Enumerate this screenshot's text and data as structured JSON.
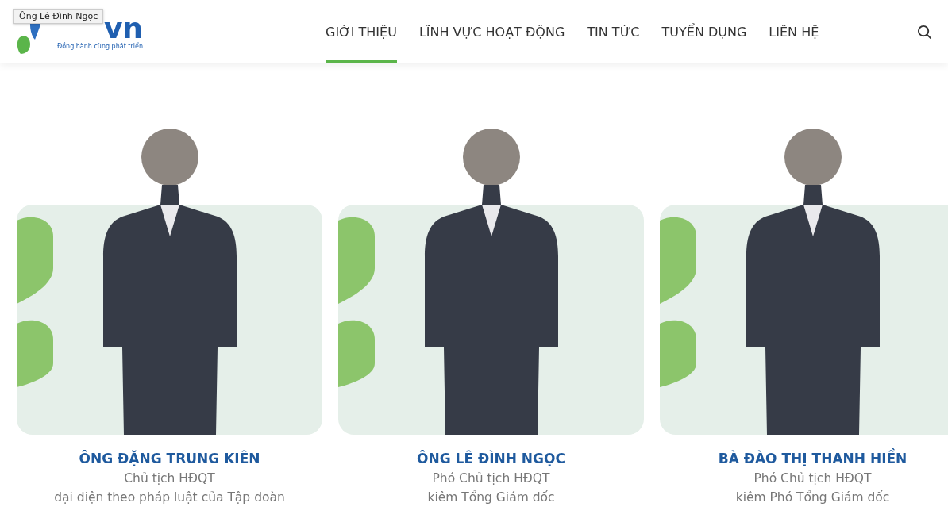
{
  "header": {
    "logo": {
      "wordmark": "vn",
      "tagline": "Đồng hành cùng phát triển"
    },
    "tooltip": "Ông Lê Đình Ngọc",
    "nav": [
      {
        "label": "GIỚI THIỆU",
        "selected": true
      },
      {
        "label": "LĨNH VỰC HOẠT ĐỘNG",
        "selected": false
      },
      {
        "label": "TIN TỨC",
        "selected": false
      },
      {
        "label": "TUYỂN DỤNG",
        "selected": false
      },
      {
        "label": "LIÊN HỆ",
        "selected": false
      }
    ]
  },
  "people": [
    {
      "name": "ÔNG ĐẶNG TRUNG KIÊN",
      "roles": [
        "Chủ tịch HĐQT",
        "đại diện theo pháp luật của Tập đoàn"
      ]
    },
    {
      "name": "ÔNG LÊ ĐÌNH NGỌC",
      "roles": [
        "Phó Chủ tịch HĐQT",
        "kiêm Tổng Giám đốc"
      ]
    },
    {
      "name": "BÀ ĐÀO THỊ THANH HIỀN",
      "roles": [
        "Phó Chủ tịch HĐQT",
        "kiêm Phó Tổng Giám đốc"
      ]
    }
  ]
}
